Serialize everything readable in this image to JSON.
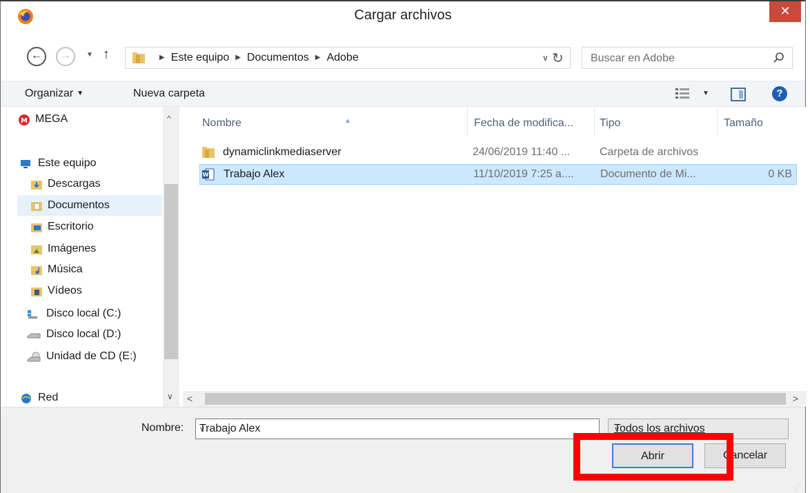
{
  "window": {
    "title": "Cargar archivos",
    "close_label": "✕"
  },
  "nav": {
    "back_glyph": "←",
    "forward_glyph": "→",
    "up_glyph": "↑",
    "breadcrumbs": [
      "Este equipo",
      "Documentos",
      "Adobe"
    ]
  },
  "search": {
    "placeholder": "Buscar en Adobe"
  },
  "toolbar": {
    "organize_label": "Organizar",
    "new_folder_label": "Nueva carpeta",
    "help_label": "?"
  },
  "sidebar": {
    "items": [
      {
        "label": "MEGA",
        "icon": "mega-icon"
      },
      {
        "label": "Este equipo",
        "icon": "computer-icon"
      },
      {
        "label": "Descargas",
        "icon": "downloads-folder-icon"
      },
      {
        "label": "Documentos",
        "icon": "documents-folder-icon",
        "selected": true
      },
      {
        "label": "Escritorio",
        "icon": "desktop-folder-icon"
      },
      {
        "label": "Imágenes",
        "icon": "pictures-folder-icon"
      },
      {
        "label": "Música",
        "icon": "music-folder-icon"
      },
      {
        "label": "Vídeos",
        "icon": "videos-folder-icon"
      },
      {
        "label": "Disco local (C:)",
        "icon": "windows-drive-icon"
      },
      {
        "label": "Disco local (D:)",
        "icon": "drive-icon"
      },
      {
        "label": "Unidad de CD (E:)",
        "icon": "cd-drive-icon"
      },
      {
        "label": "Red",
        "icon": "network-icon"
      }
    ]
  },
  "columns": {
    "name": "Nombre",
    "modified": "Fecha de modifica...",
    "type": "Tipo",
    "size": "Tamaño"
  },
  "files": [
    {
      "name": "dynamiclinkmediaserver",
      "modified": "24/06/2019 11:40 ...",
      "type": "Carpeta de archivos",
      "size": "",
      "icon": "folder-icon"
    },
    {
      "name": "Trabajo Alex",
      "modified": "11/10/2019 7:25 a....",
      "type": "Documento de Mi...",
      "size": "0 KB",
      "icon": "word-document-icon",
      "selected": true
    }
  ],
  "footer": {
    "filename_label": "Nombre:",
    "filename_value": "Trabajo Alex",
    "filter_value": "Todos los archivos",
    "open_label": "Abrir",
    "cancel_label": "Cancelar"
  },
  "colors": {
    "selection": "#cce8ff",
    "highlight": "#ff0000",
    "close": "#c84a3a"
  }
}
